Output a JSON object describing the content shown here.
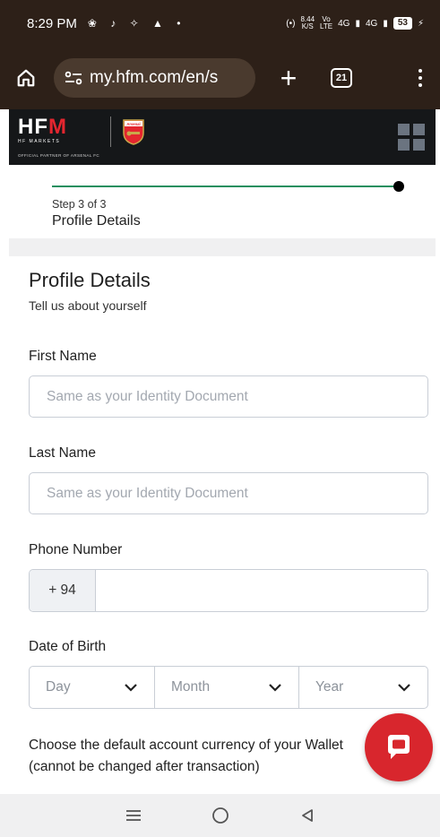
{
  "status_bar": {
    "time": "8:29 PM",
    "notif_icons": "❀ ♪ ✧ ▲ •",
    "speed_value": "8.44",
    "speed_unit": "K/S",
    "volte_top": "Vo",
    "volte_bottom": "LTE",
    "net1": "4G",
    "net2": "4G",
    "battery": "53"
  },
  "browser": {
    "url": "my.hfm.com/en/s",
    "tab_count": "21"
  },
  "site_header": {
    "logo_hf": "HF",
    "logo_m": "M",
    "logo_sub": "HF MARKETS",
    "partner_text": "OFFICIAL PARTNER OF ARSENAL FC",
    "crest_text": "Arsenal"
  },
  "stepper": {
    "step_label": "Step 3 of 3",
    "step_title": "Profile Details",
    "progress": 1.0
  },
  "form": {
    "title": "Profile Details",
    "subtitle": "Tell us about yourself",
    "first_name_label": "First Name",
    "first_name_placeholder": "Same as your Identity Document",
    "last_name_label": "Last Name",
    "last_name_placeholder": "Same as your Identity Document",
    "phone_label": "Phone Number",
    "phone_code": "+ 94",
    "dob_label": "Date of Birth",
    "dob_day": "Day",
    "dob_month": "Month",
    "dob_year": "Year",
    "currency_text": "Choose the default account currency of your Wallet (cannot be changed after transaction)"
  },
  "colors": {
    "status_bg": "#2d2018",
    "header_bg": "#151719",
    "brand_red": "#d8262d",
    "progress_green": "#1f8f5f"
  }
}
